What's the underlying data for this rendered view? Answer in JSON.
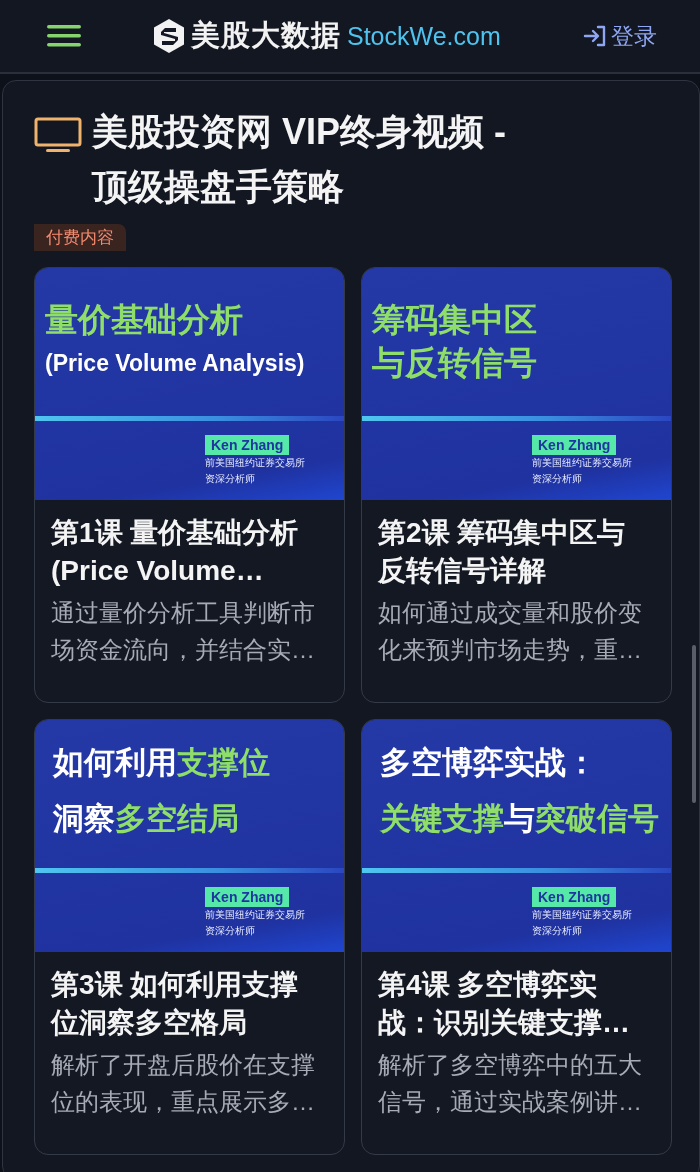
{
  "header": {
    "brand": "美股大数据",
    "domain": "StockWe.com",
    "login": "登录"
  },
  "page": {
    "title": "美股投资网 VIP终身视频 - 顶级操盘手策略",
    "tag": "付费内容"
  },
  "courses": [
    {
      "thumbnail": {
        "lines": [
          [
            {
              "text": "量价基础分析",
              "highlight": true
            }
          ],
          [
            {
              "text": "(Price Volume Analysis)",
              "highlight": false
            }
          ]
        ],
        "author": "Ken Zhang",
        "author_title": [
          "前美国纽约证券交易所",
          "资深分析师"
        ]
      },
      "title": "第1课 量价基础分析 (Price Volume…",
      "description": "通过量价分析工具判断市场资金流向，并结合实…"
    },
    {
      "thumbnail": {
        "lines": [
          [
            {
              "text": "筹码集中区",
              "highlight": true
            }
          ],
          [
            {
              "text": "与反转信号",
              "highlight": true
            }
          ]
        ],
        "author": "Ken Zhang",
        "author_title": [
          "前美国纽约证券交易所",
          "资深分析师"
        ]
      },
      "title": "第2课 筹码集中区与反转信号详解",
      "description": "如何通过成交量和股价变化来预判市场走势，重…"
    },
    {
      "thumbnail": {
        "lines": [
          [
            {
              "text": "如何利用",
              "highlight": false
            },
            {
              "text": "支撑位",
              "highlight": true
            }
          ],
          [
            {
              "text": "洞察",
              "highlight": false
            },
            {
              "text": "多空结局",
              "highlight": true
            }
          ]
        ],
        "author": "Ken Zhang",
        "author_title": [
          "前美国纽约证券交易所",
          "资深分析师"
        ]
      },
      "title": "第3课 如何利用支撑位洞察多空格局",
      "description": "解析了开盘后股价在支撑位的表现，重点展示多…"
    },
    {
      "thumbnail": {
        "lines": [
          [
            {
              "text": "多空博弈实战：",
              "highlight": false
            }
          ],
          [
            {
              "text": "关键支撑",
              "highlight": true
            },
            {
              "text": "与",
              "highlight": false
            },
            {
              "text": "突破信号",
              "highlight": true
            }
          ]
        ],
        "author": "Ken Zhang",
        "author_title": [
          "前美国纽约证券交易所",
          "资深分析师"
        ]
      },
      "title": "第4课 多空博弈实战：识别关键支撑…",
      "description": "解析了多空博弈中的五大信号，通过实战案例讲…"
    }
  ]
}
